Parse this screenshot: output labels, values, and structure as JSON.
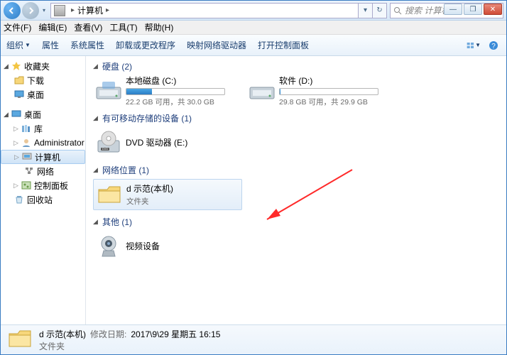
{
  "window": {
    "min": "—",
    "max": "❐",
    "close": "✕"
  },
  "breadcrumb": {
    "location": "计算机",
    "sep": "▸"
  },
  "search": {
    "placeholder": "搜索 计算机"
  },
  "menubar": [
    "文件(F)",
    "编辑(E)",
    "查看(V)",
    "工具(T)",
    "帮助(H)"
  ],
  "toolbar": {
    "organize": "组织",
    "items": [
      "属性",
      "系统属性",
      "卸载或更改程序",
      "映射网络驱动器",
      "打开控制面板"
    ]
  },
  "sidebar": {
    "favorites": {
      "title": "收藏夹",
      "items": [
        "下载",
        "桌面"
      ]
    },
    "desktop": {
      "title": "桌面",
      "items": [
        {
          "label": "库",
          "children": []
        },
        {
          "label": "Administrator",
          "children": []
        },
        {
          "label": "计算机",
          "selected": true,
          "children": []
        },
        {
          "label": "网络",
          "children": []
        },
        {
          "label": "控制面板",
          "children": []
        },
        {
          "label": "回收站",
          "children": []
        }
      ]
    }
  },
  "content": {
    "hdd": {
      "title": "硬盘 (2)",
      "drives": [
        {
          "name": "本地磁盘 (C:)",
          "free": "22.2 GB 可用，共 30.0 GB",
          "fill_pct": 26
        },
        {
          "name": "软件 (D:)",
          "free": "29.8 GB 可用，共 29.9 GB",
          "fill_pct": 1
        }
      ]
    },
    "removable": {
      "title": "有可移动存储的设备 (1)",
      "items": [
        {
          "name": "DVD 驱动器 (E:)"
        }
      ]
    },
    "network": {
      "title": "网络位置 (1)",
      "items": [
        {
          "name": "d 示范(本机)",
          "type": "文件夹",
          "selected": true
        }
      ]
    },
    "other": {
      "title": "其他 (1)",
      "items": [
        {
          "name": "视频设备"
        }
      ]
    }
  },
  "details": {
    "name": "d 示范(本机)",
    "modified_label": "修改日期:",
    "modified_value": "2017\\9\\29 星期五 16:15",
    "type": "文件夹"
  }
}
